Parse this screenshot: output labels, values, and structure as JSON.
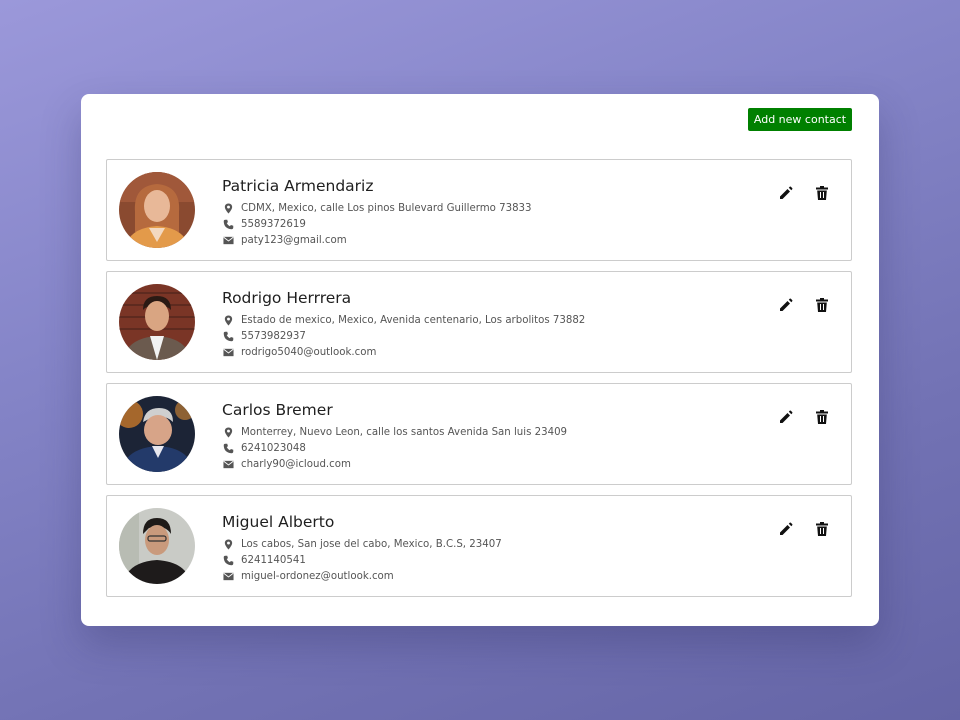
{
  "toolbar": {
    "add_label": "Add new contact"
  },
  "contacts": [
    {
      "name": "Patricia Armendariz",
      "address": "CDMX, Mexico, calle Los pinos Bulevard Guillermo 73833",
      "phone": "5589372619",
      "email": "paty123@gmail.com"
    },
    {
      "name": "Rodrigo Herrrera",
      "address": "Estado de mexico, Mexico, Avenida centenario, Los arbolitos 73882",
      "phone": "5573982937",
      "email": "rodrigo5040@outlook.com"
    },
    {
      "name": "Carlos Bremer",
      "address": "Monterrey, Nuevo Leon, calle los santos Avenida San luis 23409",
      "phone": "6241023048",
      "email": "charly90@icloud.com"
    },
    {
      "name": "Miguel Alberto",
      "address": "Los cabos, San jose del cabo, Mexico, B.C.S, 23407",
      "phone": "6241140541",
      "email": "miguel-ordonez@outlook.com"
    }
  ],
  "colors": {
    "accent_button": "#008000",
    "text": "#1f1f1f",
    "muted": "#555555"
  },
  "icons": [
    "location-pin-icon",
    "phone-icon",
    "mail-icon",
    "pencil-icon",
    "trash-icon"
  ]
}
